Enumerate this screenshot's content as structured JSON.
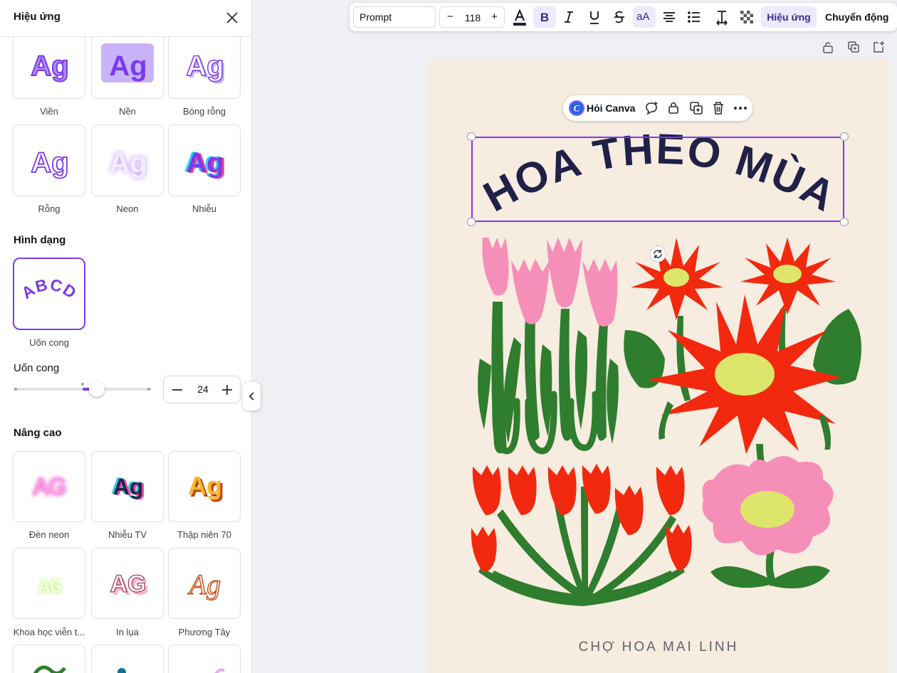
{
  "panel": {
    "title": "Hiệu ứng",
    "styles_row1": [
      "Viền",
      "Nền",
      "Bóng rỗng"
    ],
    "styles_row2": [
      "Rỗng",
      "Neon",
      "Nhiễu"
    ],
    "sample_text": "Ag",
    "shape_section": "Hình dạng",
    "shape_sample": "ABCD",
    "shape_label": "Uốn cong",
    "slider_label": "Uốn cong",
    "slider_value": "24",
    "advanced_section": "Nâng cao",
    "advanced_row1": [
      "Đèn neon",
      "Nhiễu TV",
      "Thập niên 70"
    ],
    "advanced_row2": [
      "Khoa học viễn t...",
      "In lụa",
      "Phương Tây"
    ],
    "advanced_samples": [
      "AG",
      "Ag",
      "Ag",
      "AG",
      "AG",
      "Ag"
    ]
  },
  "toolbar": {
    "font": "Prompt",
    "size_minus": "−",
    "size": "118",
    "size_plus": "+",
    "case_label": "aA",
    "effects": "Hiệu ứng",
    "motion": "Chuyển động"
  },
  "canvas": {
    "ask_canva": "Hỏi Canva",
    "headline": "HOA THEO MÙA",
    "footer": "CHỢ HOA MAI LINH"
  },
  "colors": {
    "accent": "#7c3aed",
    "accent_soft": "#ede9fe",
    "headline": "#1f2148",
    "page_bg": "#f6ecdf",
    "red_flower": "#f2290f",
    "pink_flower": "#f58fb8",
    "leaf_green": "#2f7d2e",
    "flower_center": "#dde56a"
  },
  "icons": [
    "close-icon",
    "chevron-left-icon",
    "minus-icon",
    "plus-icon",
    "bold-icon",
    "italic-icon",
    "underline-icon",
    "strikethrough-icon",
    "align-center-icon",
    "list-icon",
    "spacing-icon",
    "transparency-icon",
    "lock-icon",
    "duplicate-icon",
    "add-page-icon",
    "canva-ai-icon",
    "comment-icon",
    "delete-icon",
    "more-icon",
    "rotate-icon"
  ]
}
